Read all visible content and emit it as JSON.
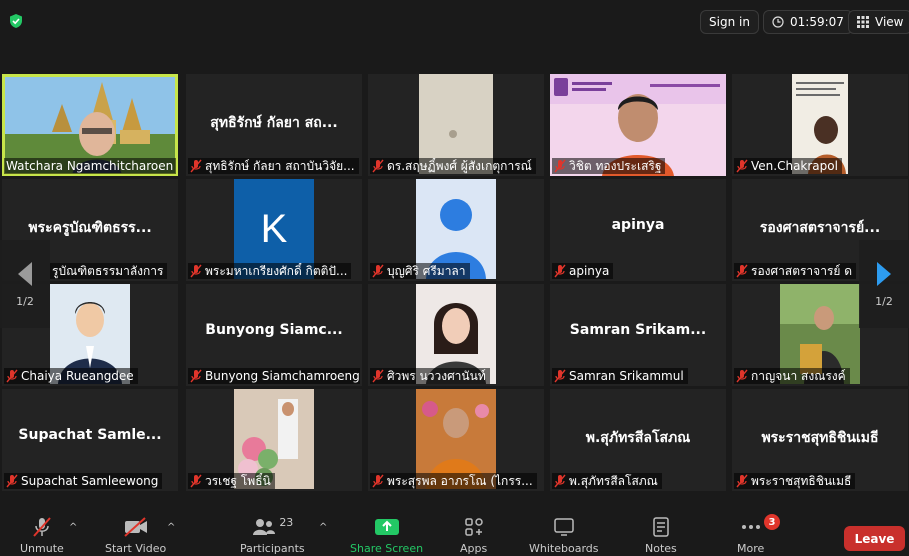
{
  "top": {
    "sign_in": "Sign in",
    "timer": "01:59:07",
    "view": "View"
  },
  "tiles": [
    {
      "big": "",
      "caption": "Watchara Ngamchitcharoen",
      "muted": false,
      "photo": "temple",
      "active": true
    },
    {
      "big": "สุทธิรักษ์ กัลยา สถ...",
      "caption": "สุทธิรักษ์ กัลยา สถาบันวิจัย...",
      "muted": true
    },
    {
      "big": "",
      "caption": "ดร.สฤษฏิ์พงศ์ ผู้สังเกตุการณ์",
      "muted": true,
      "photo": "beige"
    },
    {
      "big": "",
      "caption": "วิชิต ทองประเสริฐ",
      "muted": true,
      "photo": "speaker"
    },
    {
      "big": "",
      "caption": "Ven.Chakrapol",
      "muted": true,
      "photo": "monkbook"
    },
    {
      "big": "พระครูบัณฑิตธรร...",
      "caption": "รูบัณฑิตธรรมาลังการ",
      "muted": false
    },
    {
      "big": "",
      "caption": "พระมหาเกรียงศักดิ์ กิตติปั...",
      "muted": true,
      "photo": "k"
    },
    {
      "big": "",
      "caption": "บุญศิริ ศรีมาลา",
      "muted": true,
      "photo": "avatar"
    },
    {
      "big": "apinya",
      "caption": "apinya",
      "muted": true
    },
    {
      "big": "รองศาสตราจารย์...",
      "caption": "รองศาสตราจารย์ ด",
      "muted": true
    },
    {
      "big": "",
      "caption": "Chaiya Rueangdee",
      "muted": true,
      "photo": "cartoon"
    },
    {
      "big": "Bunyong  Siamc...",
      "caption": "Bunyong Siamchamroeng",
      "muted": true
    },
    {
      "big": "",
      "caption": "ศิวพร นววงศานันท์",
      "muted": true,
      "photo": "woman"
    },
    {
      "big": "Samran  Srikam...",
      "caption": "Samran  Srikammul",
      "muted": true
    },
    {
      "big": "",
      "caption": "กาญจนา สงณรงค์",
      "muted": true,
      "photo": "outdoor"
    },
    {
      "big": "Supachat  Samle...",
      "caption": "Supachat Samleewong",
      "muted": true
    },
    {
      "big": "",
      "caption": "วรเชฐ โพธิ์นิ",
      "muted": true,
      "photo": "ceremony"
    },
    {
      "big": "",
      "caption": "พระสุรพล อาภรโณ (ไกรร...",
      "muted": true,
      "photo": "monk"
    },
    {
      "big": "พ.สุภัทรสีลโสภณ",
      "caption": "พ.สุภัทรสีลโสภณ",
      "muted": true
    },
    {
      "big": "พระราชสุทธิชินเมธี",
      "caption": "พระราชสุทธิชินเมธี",
      "muted": true
    }
  ],
  "nav": {
    "page_left": "1/2",
    "page_right": "1/2"
  },
  "toolbar": {
    "unmute": "Unmute",
    "start_video": "Start Video",
    "participants": "Participants",
    "participants_count": "23",
    "share_screen": "Share Screen",
    "apps": "Apps",
    "whiteboards": "Whiteboards",
    "notes": "Notes",
    "more": "More",
    "more_badge": "3",
    "leave": "Leave"
  },
  "colors": {
    "active_speaker": "#c7e54a",
    "share_green": "#23c865",
    "leave_red": "#c9302c",
    "mute_red": "#e0352b"
  }
}
